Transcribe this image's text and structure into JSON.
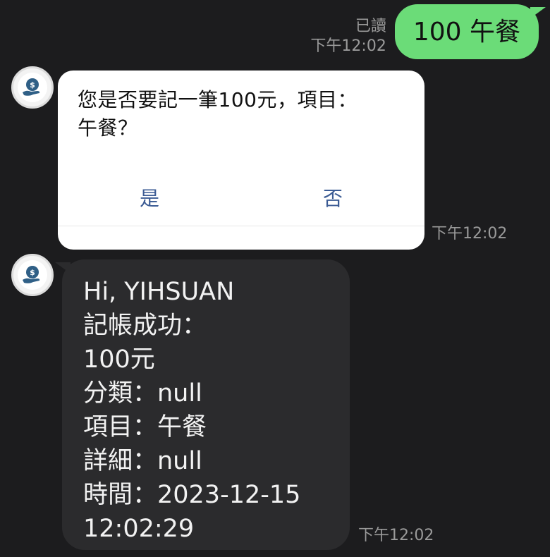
{
  "outgoing": {
    "read_label": "已讀",
    "time": "下午12:02",
    "text": "100 午餐"
  },
  "confirm": {
    "question_line1": "您是否要記一筆100元，項目：",
    "question_line2": "午餐？",
    "yes_label": "是",
    "no_label": "否",
    "time": "下午12:02"
  },
  "reply": {
    "lines": [
      "Hi, YIHSUAN",
      "記帳成功：",
      "100元",
      "分類：null",
      "項目：午餐",
      "詳細：null",
      "時間：2023-12-15",
      "12:02:29"
    ],
    "time": "下午12:02"
  },
  "icons": {
    "bot_avatar": "money-hand-icon"
  },
  "colors": {
    "background": "#1c1c1e",
    "outgoing_bubble": "#6bdc78",
    "incoming_bubble": "#2b2b2d",
    "card_button_text": "#3b5b94",
    "timestamp": "#9a9a9a"
  }
}
